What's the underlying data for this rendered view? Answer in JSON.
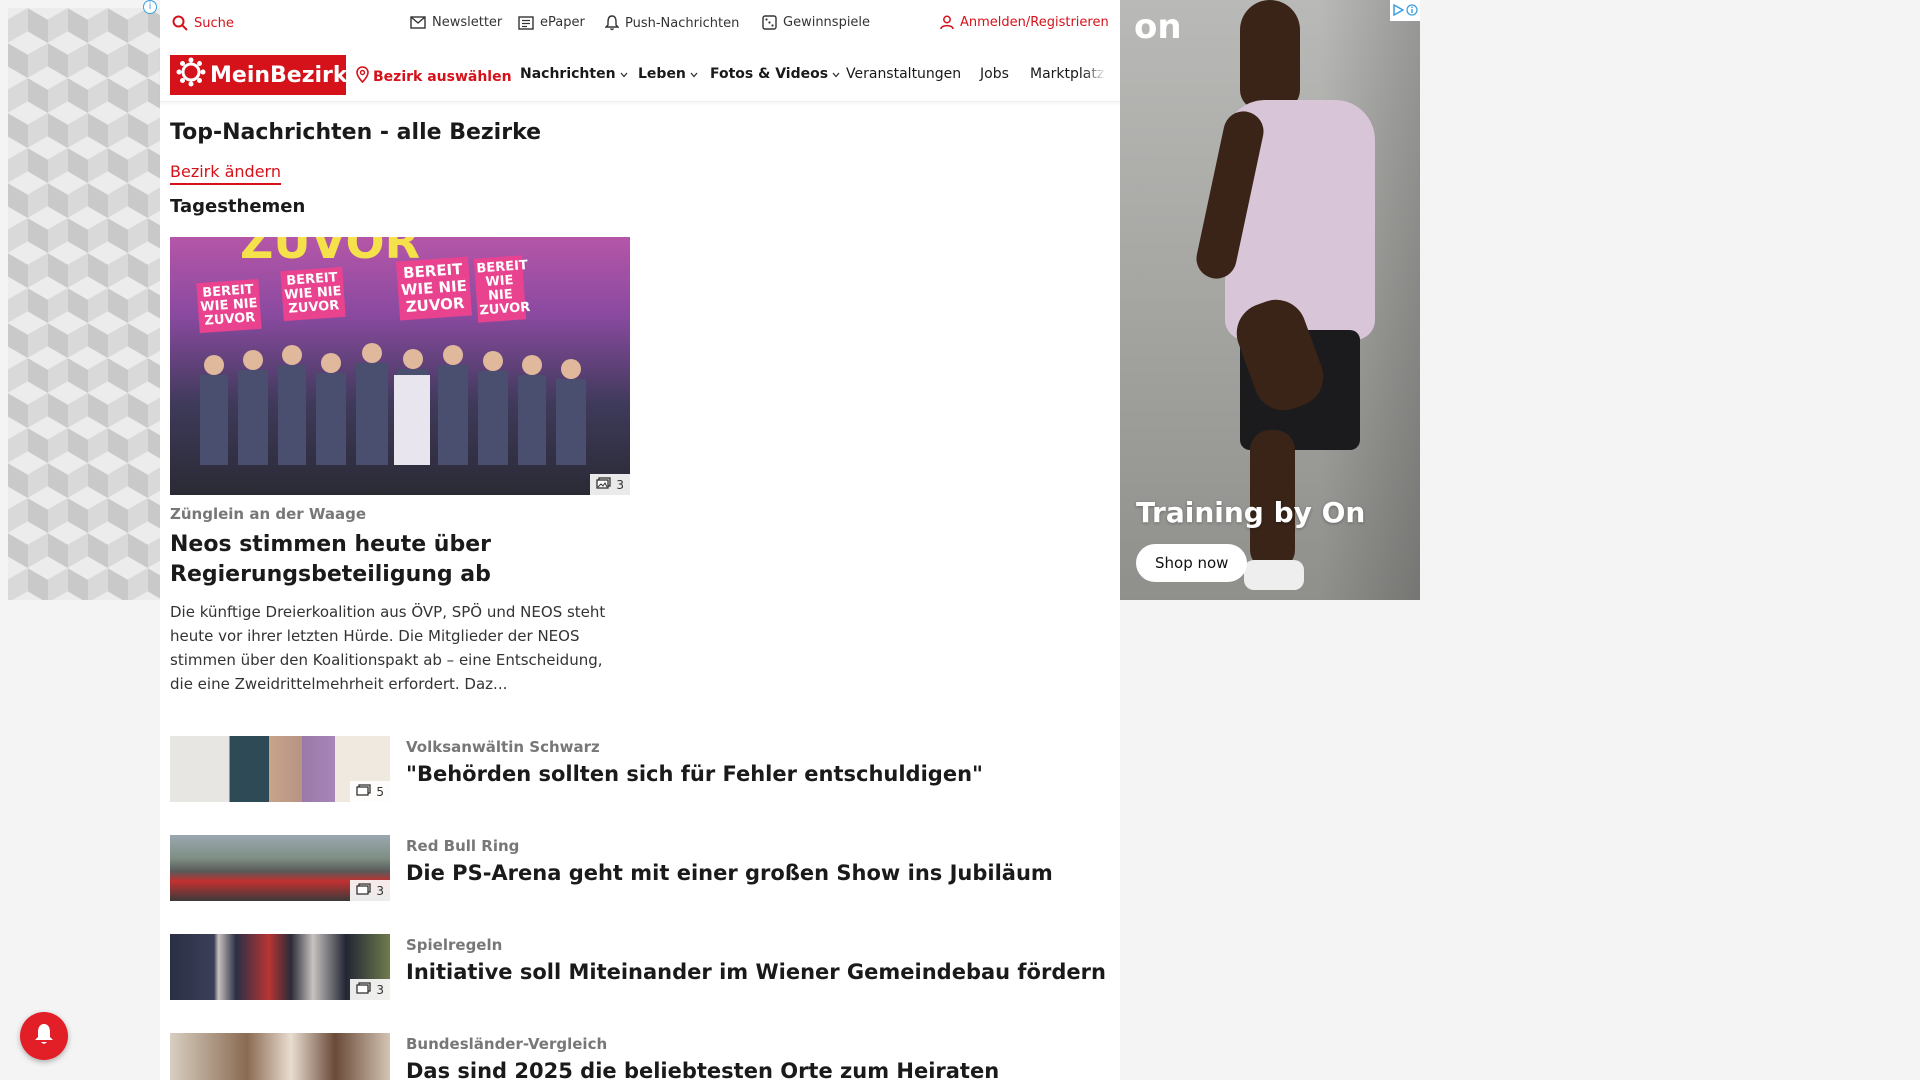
{
  "topbar": {
    "search": "Suche",
    "newsletter": "Newsletter",
    "epaper": "ePaper",
    "push": "Push-Nachrichten",
    "gewinnspiele": "Gewinnspiele",
    "login": "Anmelden/Registrieren"
  },
  "nav": {
    "logo": "MeinBezirk",
    "district": "Bezirk auswählen",
    "items": [
      "Nachrichten",
      "Leben",
      "Fotos & Videos",
      "Veranstaltungen",
      "Jobs",
      "Marktplatz"
    ]
  },
  "page": {
    "title": "Top-Nachrichten - alle Bezirke",
    "change_district": "Bezirk ändern",
    "section": "Tagesthemen"
  },
  "hero": {
    "image_count": "3",
    "sign_text": "BEREIT WIE NIE ZUVOR",
    "banner_text": "ZUVOR",
    "kicker": "Zünglein an der Waage",
    "title": "Neos stimmen heute über Regierungsbeteiligung ab",
    "teaser": "Die künftige Dreierkoalition aus ÖVP, SPÖ und NEOS steht heute vor ihrer letzten Hürde. Die Mitglieder der NEOS stimmen über den Koalitionspakt ab – eine Entscheidung, die eine Zweidrittelmehrheit erfordert. Daz..."
  },
  "articles": [
    {
      "kicker": "Volksanwältin Schwarz",
      "title": "\"Behörden sollten sich für Fehler entschuldigen\"",
      "image_count": "5"
    },
    {
      "kicker": "Red Bull Ring",
      "title": "Die PS-Arena geht mit einer großen Show ins Jubiläum",
      "image_count": "3"
    },
    {
      "kicker": "Spielregeln",
      "title": "Initiative soll Miteinander im Wiener Gemeindebau fördern",
      "image_count": "3"
    },
    {
      "kicker": "Bundesländer-Vergleich",
      "title": "Das sind 2025 die beliebtesten Orte zum Heiraten",
      "image_count": ""
    }
  ],
  "ad": {
    "brand": "on",
    "headline": "Training by On",
    "cta": "Shop now"
  },
  "colors": {
    "brand_red": "#d5121a",
    "text": "#1a1a1a",
    "kicker_grey": "#777777"
  }
}
